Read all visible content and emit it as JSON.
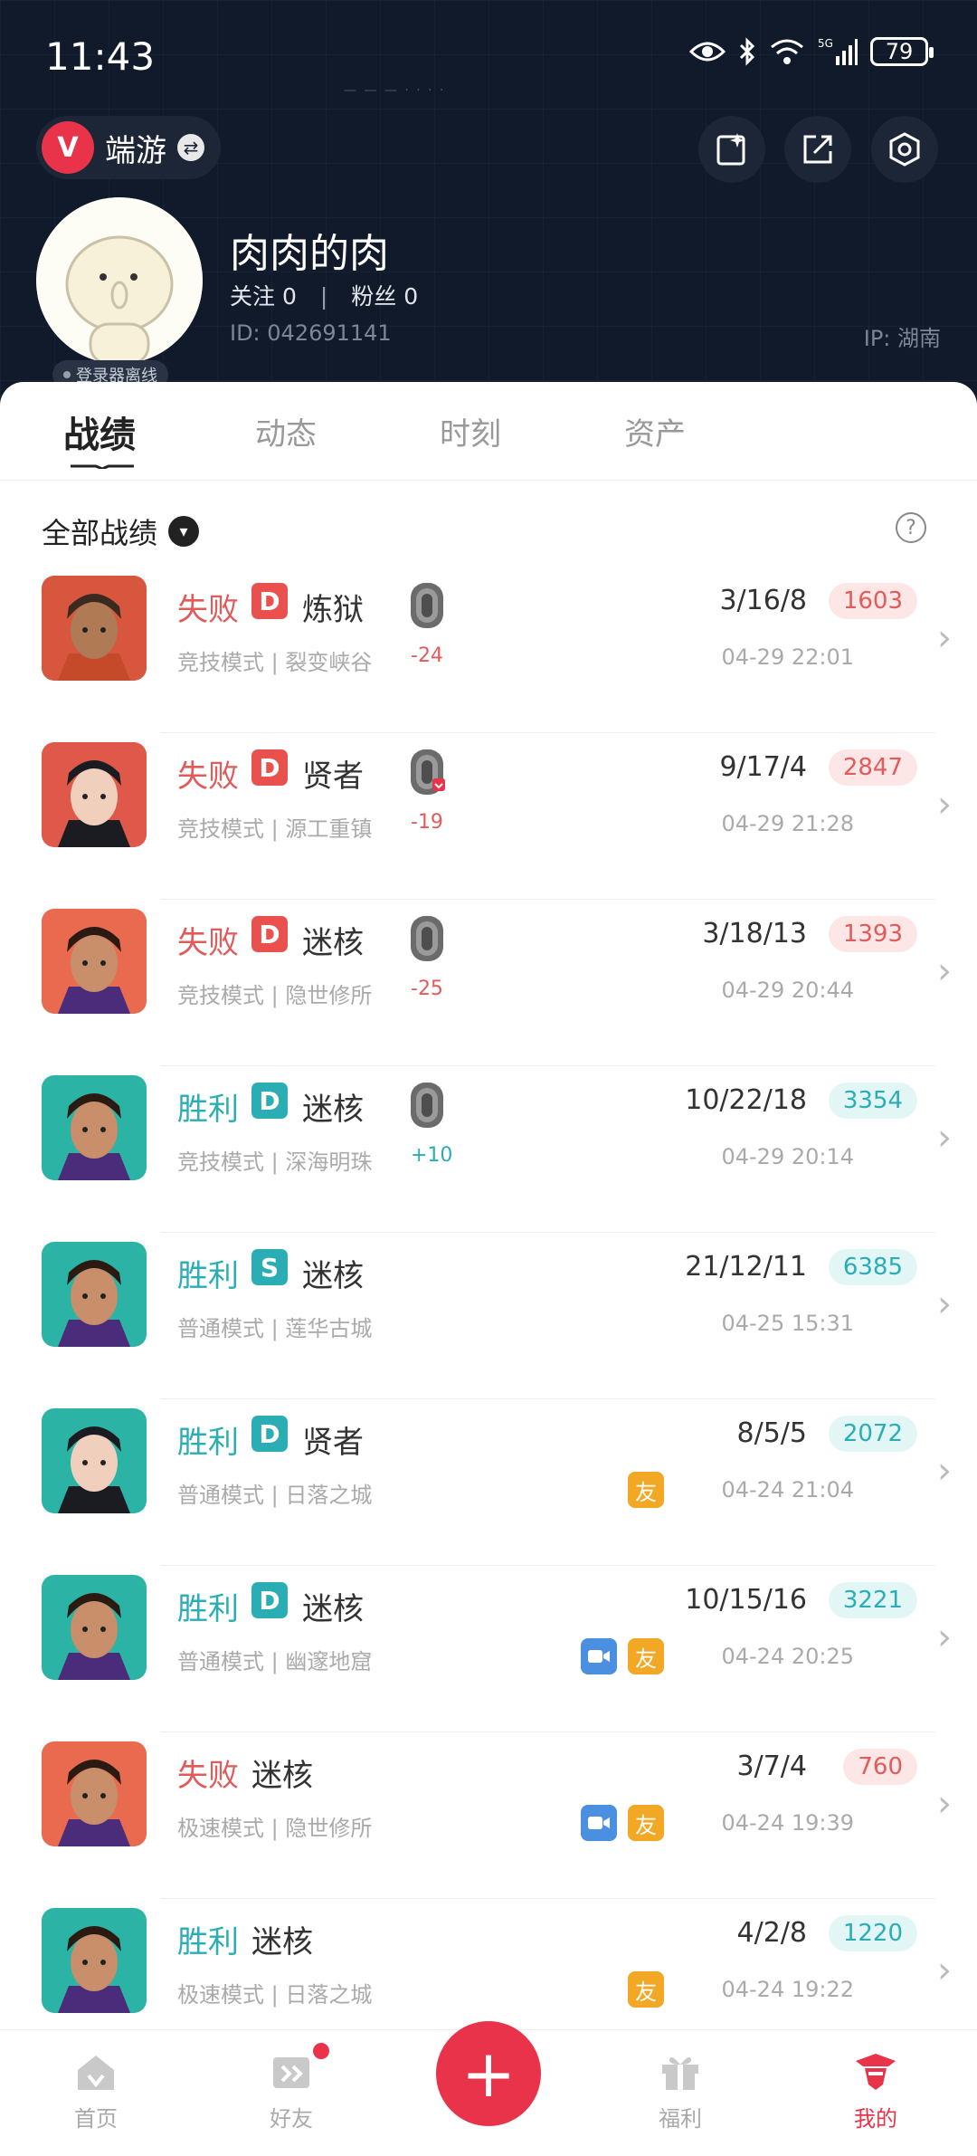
{
  "status_bar": {
    "time": "11:43",
    "battery": "79"
  },
  "header": {
    "app_name": "端游",
    "nickname": "肉肉的肉",
    "following_label": "关注",
    "following_count": "0",
    "followers_label": "粉丝",
    "followers_count": "0",
    "id_text": "ID:  042691141",
    "ip_text": "IP:  湖南",
    "offline_status": "登录器离线"
  },
  "tabs": [
    "战绩",
    "动态",
    "时刻",
    "资产"
  ],
  "filter": {
    "label": "全部战绩"
  },
  "matches": [
    {
      "result": "失败",
      "rank": "D",
      "agent": "炼狱",
      "mode": "竞技模式 | 裂变峡谷",
      "rr_change": "-24",
      "kda": "3/16/8",
      "score": "1603",
      "date": "04-29 22:01",
      "badges": []
    },
    {
      "result": "失败",
      "rank": "D",
      "agent": "贤者",
      "mode": "竞技模式 | 源工重镇",
      "rr_change": "-19",
      "kda": "9/17/4",
      "score": "2847",
      "date": "04-29 21:28",
      "badges": []
    },
    {
      "result": "失败",
      "rank": "D",
      "agent": "迷核",
      "mode": "竞技模式 | 隐世修所",
      "rr_change": "-25",
      "kda": "3/18/13",
      "score": "1393",
      "date": "04-29 20:44",
      "badges": []
    },
    {
      "result": "胜利",
      "rank": "D",
      "agent": "迷核",
      "mode": "竞技模式 | 深海明珠",
      "rr_change": "+10",
      "kda": "10/22/18",
      "score": "3354",
      "date": "04-29 20:14",
      "badges": []
    },
    {
      "result": "胜利",
      "rank": "S",
      "agent": "迷核",
      "mode": "普通模式 | 莲华古城",
      "rr_change": "",
      "kda": "21/12/11",
      "score": "6385",
      "date": "04-25 15:31",
      "badges": []
    },
    {
      "result": "胜利",
      "rank": "D",
      "agent": "贤者",
      "mode": "普通模式 | 日落之城",
      "rr_change": "",
      "kda": "8/5/5",
      "score": "2072",
      "date": "04-24 21:04",
      "badges": [
        "友"
      ]
    },
    {
      "result": "胜利",
      "rank": "D",
      "agent": "迷核",
      "mode": "普通模式 | 幽邃地窟",
      "rr_change": "",
      "kda": "10/15/16",
      "score": "3221",
      "date": "04-24 20:25",
      "badges": [
        "video",
        "友"
      ]
    },
    {
      "result": "失败",
      "rank": "",
      "agent": "迷核",
      "mode": "极速模式 | 隐世修所",
      "rr_change": "",
      "kda": "3/7/4",
      "score": "760",
      "date": "04-24 19:39",
      "badges": [
        "video",
        "友"
      ]
    },
    {
      "result": "胜利",
      "rank": "",
      "agent": "迷核",
      "mode": "极速模式 | 日落之城",
      "rr_change": "",
      "kda": "4/2/8",
      "score": "1220",
      "date": "04-24 19:22",
      "badges": [
        "友"
      ]
    }
  ],
  "bottom_nav": [
    "首页",
    "好友",
    "福利",
    "我的"
  ],
  "colors": {
    "accent": "#e8334a",
    "win": "#2aaeb4",
    "lose": "#e25b5b",
    "header_bg": "#101a2a"
  }
}
